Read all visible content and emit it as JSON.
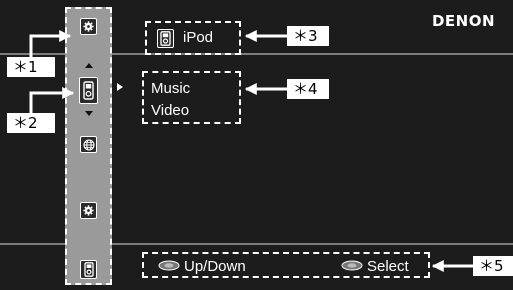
{
  "brand": "DENON",
  "source": {
    "label": "iPod",
    "icon": "ipod-icon"
  },
  "menu": {
    "items": [
      "Music",
      "Video"
    ]
  },
  "sidebar": {
    "icons": [
      "settings-gear-icon",
      "ipod-icon",
      "network-globe-icon",
      "settings-gear-icon",
      "ipod-icon"
    ]
  },
  "guide": {
    "up_down": "Up/Down",
    "select": "Select"
  },
  "callouts": [
    "＊1",
    "＊2",
    "＊3",
    "＊4",
    "＊5"
  ]
}
